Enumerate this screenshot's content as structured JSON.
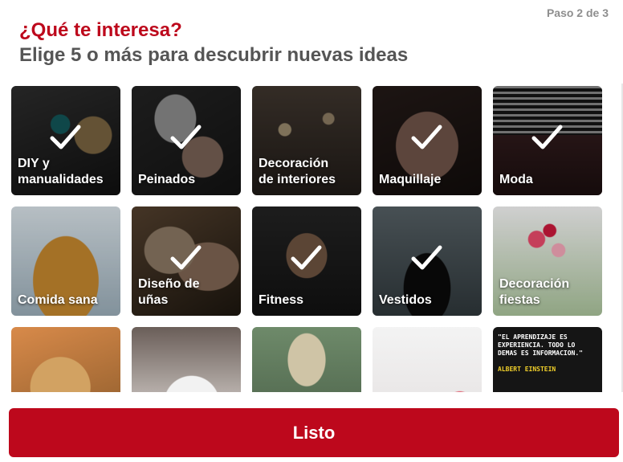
{
  "header": {
    "step": "Paso 2 de 3",
    "title": "¿Qué te interesa?",
    "subtitle": "Elige 5 o más para descubrir nuevas ideas"
  },
  "colors": {
    "brand": "#bd081c",
    "subtitle": "#555555",
    "step": "#8e8e8e"
  },
  "topics": [
    {
      "label": "DIY y\nmanualidades",
      "selected": true
    },
    {
      "label": "Peinados",
      "selected": true
    },
    {
      "label": "Decoración\nde interiores",
      "selected": false
    },
    {
      "label": "Maquillaje",
      "selected": true
    },
    {
      "label": "Moda",
      "selected": true
    },
    {
      "label": "Comida sana",
      "selected": false
    },
    {
      "label": "Diseño de\nuñas",
      "selected": true
    },
    {
      "label": "Fitness",
      "selected": true
    },
    {
      "label": "Vestidos",
      "selected": true
    },
    {
      "label": "Decoración\nfiestas",
      "selected": false
    },
    {
      "label": "",
      "selected": false
    },
    {
      "label": "",
      "selected": false
    },
    {
      "label": "",
      "selected": false
    },
    {
      "label": "",
      "selected": false
    },
    {
      "label": "",
      "selected": false
    }
  ],
  "quote_tile": {
    "text": "\"EL APRENDIZAJE ES\nEXPERIENCIA. TODO LO\nDEMAS ES INFORMACION.\"",
    "author": "ALBERT EINSTEIN"
  },
  "footer": {
    "done_label": "Listo"
  },
  "icons": {
    "check": "check-icon"
  }
}
